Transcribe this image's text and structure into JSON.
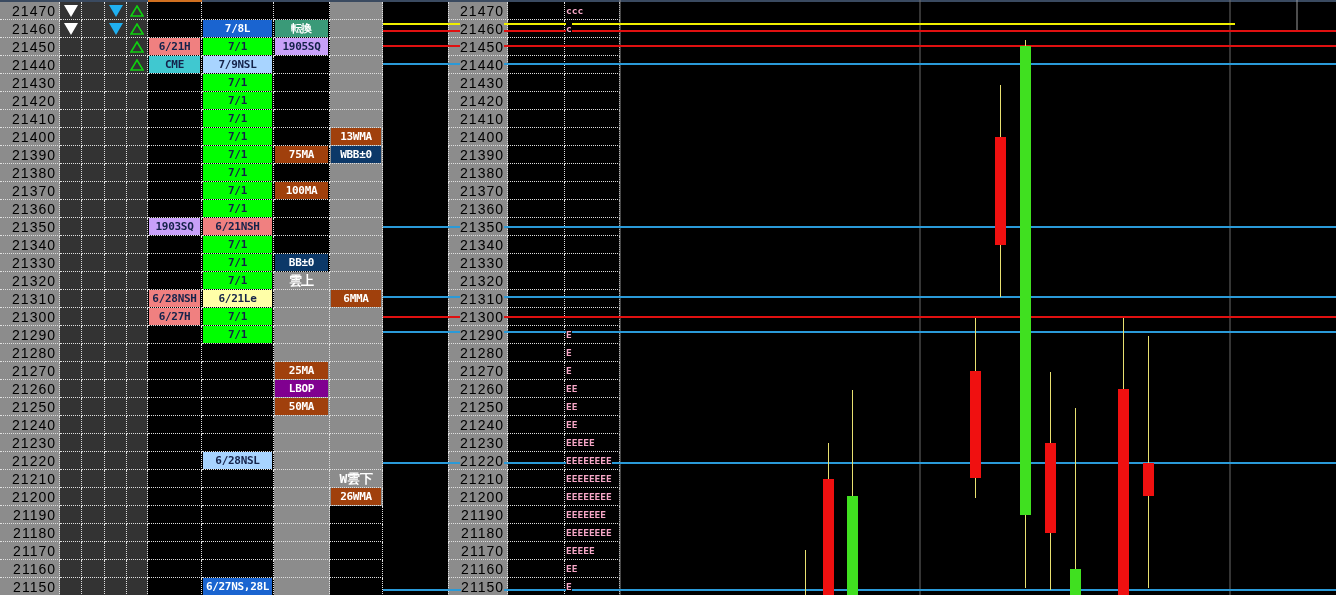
{
  "rows": [
    {
      "price": "21470",
      "white_down_mark": true,
      "blue_down_mark": true,
      "green_up_mark": true,
      "c_dark": true,
      "d_dark": false,
      "chart_price": "21470",
      "profile": "ccc"
    },
    {
      "price": "21460",
      "white_down_mark": true,
      "blue_down_mark": true,
      "green_up_mark": true,
      "b": {
        "text": "7/8L",
        "color": "#1a64d0"
      },
      "c": {
        "text": "転換",
        "color": "#3a9a78"
      },
      "c_dark": true,
      "d_dark": false,
      "chart_price": "21460",
      "profile": "c"
    },
    {
      "price": "21450",
      "white_down_mark": false,
      "blue_down_mark": false,
      "green_up_mark": true,
      "a": {
        "text": "6/21H",
        "color": "#f08080"
      },
      "b": {
        "text": "7/1",
        "color": "#00ff00"
      },
      "c": {
        "text": "1905SQ",
        "color": "#c8a0f8"
      },
      "c_dark": true,
      "d_dark": false,
      "chart_price": "21450"
    },
    {
      "price": "21440",
      "white_down_mark": false,
      "blue_down_mark": false,
      "green_up_mark": true,
      "a": {
        "text": "CME",
        "color": "#40c8d0"
      },
      "b": {
        "text": "7/9NSL",
        "color": "#a8d4ff"
      },
      "c_dark": true,
      "d_dark": false,
      "chart_price": "21440"
    },
    {
      "price": "21430",
      "white_down_mark": false,
      "blue_down_mark": false,
      "green_up_mark": false,
      "b": {
        "text": "7/1",
        "color": "#00ff00"
      },
      "c_dark": true,
      "d_dark": false,
      "chart_price": "21430"
    },
    {
      "price": "21420",
      "white_down_mark": false,
      "blue_down_mark": false,
      "green_up_mark": false,
      "b": {
        "text": "7/1",
        "color": "#00ff00"
      },
      "c_dark": true,
      "d_dark": false,
      "chart_price": "21420"
    },
    {
      "price": "21410",
      "white_down_mark": false,
      "blue_down_mark": false,
      "green_up_mark": false,
      "b": {
        "text": "7/1",
        "color": "#00ff00"
      },
      "c_dark": true,
      "d_dark": false,
      "chart_price": "21410"
    },
    {
      "price": "21400",
      "white_down_mark": false,
      "blue_down_mark": false,
      "green_up_mark": false,
      "b": {
        "text": "7/1",
        "color": "#00ff00"
      },
      "d": {
        "text": "13WMA",
        "color": "#a0400c"
      },
      "c_dark": true,
      "d_dark": false,
      "chart_price": "21400"
    },
    {
      "price": "21390",
      "white_down_mark": false,
      "blue_down_mark": false,
      "green_up_mark": false,
      "b": {
        "text": "7/1",
        "color": "#00ff00"
      },
      "c": {
        "text": "75MA",
        "color": "#a0400c"
      },
      "d": {
        "text": "WBB±0",
        "color": "#0c3868"
      },
      "c_dark": true,
      "d_dark": false,
      "chart_price": "21390"
    },
    {
      "price": "21380",
      "white_down_mark": false,
      "blue_down_mark": false,
      "green_up_mark": false,
      "b": {
        "text": "7/1",
        "color": "#00ff00"
      },
      "c_dark": true,
      "d_dark": false,
      "chart_price": "21380"
    },
    {
      "price": "21370",
      "white_down_mark": false,
      "blue_down_mark": false,
      "green_up_mark": false,
      "b": {
        "text": "7/1",
        "color": "#00ff00"
      },
      "c": {
        "text": "100MA",
        "color": "#a0400c"
      },
      "c_dark": true,
      "d_dark": false,
      "chart_price": "21370"
    },
    {
      "price": "21360",
      "white_down_mark": false,
      "blue_down_mark": false,
      "green_up_mark": false,
      "b": {
        "text": "7/1",
        "color": "#00ff00"
      },
      "c_dark": true,
      "d_dark": false,
      "chart_price": "21360"
    },
    {
      "price": "21350",
      "white_down_mark": false,
      "blue_down_mark": false,
      "green_up_mark": false,
      "a": {
        "text": "1903SQ",
        "color": "#c8a0f8"
      },
      "b": {
        "text": "6/21NSH",
        "color": "#f08080"
      },
      "c_dark": true,
      "d_dark": false,
      "chart_price": "21350"
    },
    {
      "price": "21340",
      "white_down_mark": false,
      "blue_down_mark": false,
      "green_up_mark": false,
      "b": {
        "text": "7/1",
        "color": "#00ff00"
      },
      "c_dark": true,
      "d_dark": false,
      "chart_price": "21340"
    },
    {
      "price": "21330",
      "white_down_mark": false,
      "blue_down_mark": false,
      "green_up_mark": false,
      "b": {
        "text": "7/1",
        "color": "#00ff00"
      },
      "c": {
        "text": "BB±0",
        "color": "#0c3868"
      },
      "c_dark": true,
      "d_dark": false,
      "chart_price": "21330"
    },
    {
      "price": "21320",
      "white_down_mark": false,
      "blue_down_mark": false,
      "green_up_mark": false,
      "b": {
        "text": "7/1",
        "color": "#00ff00"
      },
      "c": {
        "text": "雲上"
      },
      "c_dark": false,
      "d_dark": false,
      "chart_price": "21320"
    },
    {
      "price": "21310",
      "white_down_mark": false,
      "blue_down_mark": false,
      "green_up_mark": false,
      "a": {
        "text": "6/28NSH",
        "color": "#f08080"
      },
      "b": {
        "text": "6/21Le",
        "color": "#ffffa8"
      },
      "d": {
        "text": "6MMA",
        "color": "#a0400c"
      },
      "c_dark": false,
      "d_dark": false,
      "chart_price": "21310"
    },
    {
      "price": "21300",
      "white_down_mark": false,
      "blue_down_mark": false,
      "green_up_mark": false,
      "a": {
        "text": "6/27H",
        "color": "#f08080"
      },
      "b": {
        "text": "7/1",
        "color": "#00ff00"
      },
      "c_dark": false,
      "d_dark": false,
      "chart_price": "21300"
    },
    {
      "price": "21290",
      "white_down_mark": false,
      "blue_down_mark": false,
      "green_up_mark": false,
      "b": {
        "text": "7/1",
        "color": "#00ff00"
      },
      "c_dark": false,
      "d_dark": false,
      "chart_price": "21290",
      "profile": "E"
    },
    {
      "price": "21280",
      "white_down_mark": false,
      "blue_down_mark": false,
      "green_up_mark": false,
      "c_dark": false,
      "d_dark": false,
      "chart_price": "21280",
      "profile": "E"
    },
    {
      "price": "21270",
      "white_down_mark": false,
      "blue_down_mark": false,
      "green_up_mark": false,
      "c": {
        "text": "25MA",
        "color": "#a0400c"
      },
      "c_dark": false,
      "d_dark": false,
      "chart_price": "21270",
      "profile": "E"
    },
    {
      "price": "21260",
      "white_down_mark": false,
      "blue_down_mark": false,
      "green_up_mark": false,
      "c": {
        "text": "LBOP",
        "color": "#800090"
      },
      "c_dark": false,
      "d_dark": false,
      "chart_price": "21260",
      "profile": "EE"
    },
    {
      "price": "21250",
      "white_down_mark": false,
      "blue_down_mark": false,
      "green_up_mark": false,
      "c": {
        "text": "50MA",
        "color": "#a0400c"
      },
      "c_dark": false,
      "d_dark": false,
      "chart_price": "21250",
      "profile": "EE"
    },
    {
      "price": "21240",
      "white_down_mark": false,
      "blue_down_mark": false,
      "green_up_mark": false,
      "c_dark": false,
      "d_dark": false,
      "chart_price": "21240",
      "profile": "EE"
    },
    {
      "price": "21230",
      "white_down_mark": false,
      "blue_down_mark": false,
      "green_up_mark": false,
      "c_dark": false,
      "d_dark": false,
      "chart_price": "21230",
      "profile": "EEEEE"
    },
    {
      "price": "21220",
      "white_down_mark": false,
      "blue_down_mark": false,
      "green_up_mark": false,
      "b": {
        "text": "6/28NSL",
        "color": "#a8d4ff"
      },
      "c_dark": false,
      "d_dark": false,
      "chart_price": "21220",
      "profile": "EEEEEEEE"
    },
    {
      "price": "21210",
      "white_down_mark": false,
      "blue_down_mark": false,
      "green_up_mark": false,
      "d": {
        "text": "W雲下"
      },
      "c_dark": false,
      "d_dark": false,
      "chart_price": "21210",
      "profile": "EEEEEEEE"
    },
    {
      "price": "21200",
      "white_down_mark": false,
      "blue_down_mark": false,
      "green_up_mark": false,
      "d": {
        "text": "26WMA",
        "color": "#a0400c"
      },
      "c_dark": false,
      "d_dark": false,
      "chart_price": "21200",
      "profile": "EEEEEEEE"
    },
    {
      "price": "21190",
      "white_down_mark": false,
      "blue_down_mark": false,
      "green_up_mark": false,
      "c_dark": false,
      "d_dark": true,
      "chart_price": "21190",
      "profile": "EEEEEEE"
    },
    {
      "price": "21180",
      "white_down_mark": false,
      "blue_down_mark": false,
      "green_up_mark": false,
      "c_dark": false,
      "d_dark": true,
      "chart_price": "21180",
      "profile": "EEEEEEEE"
    },
    {
      "price": "21170",
      "white_down_mark": false,
      "blue_down_mark": false,
      "green_up_mark": false,
      "c_dark": false,
      "d_dark": true,
      "chart_price": "21170",
      "profile": "EEEEE"
    },
    {
      "price": "21160",
      "white_down_mark": false,
      "blue_down_mark": false,
      "green_up_mark": false,
      "c_dark": false,
      "d_dark": true,
      "chart_price": "21160",
      "profile": "EE"
    },
    {
      "price": "21150",
      "white_down_mark": false,
      "blue_down_mark": false,
      "green_up_mark": false,
      "b": {
        "text": "6/27NS,28L",
        "color": "#1a64d0"
      },
      "c_dark": false,
      "d_dark": true,
      "chart_price": "21150",
      "profile": "E"
    }
  ]
}
